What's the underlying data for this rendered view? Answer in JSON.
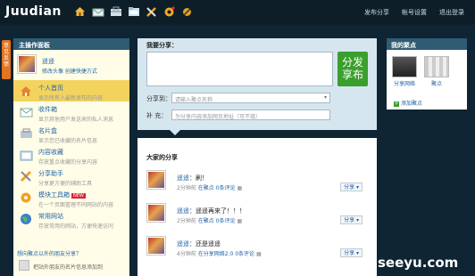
{
  "app": {
    "logo": "Juudian"
  },
  "nav_icons": [
    "home-icon",
    "mail-icon",
    "bag-icon",
    "folder-icon",
    "tools-icon",
    "gear-icon",
    "settings-icon"
  ],
  "top_links": [
    "发布分享",
    "帐号设置",
    "退出登录"
  ],
  "side_tab": "意见反馈",
  "sidebar": {
    "title": "主操作面板",
    "user": {
      "name": "遥遥",
      "links": "修改头像  创建快捷方式"
    },
    "items": [
      {
        "title": "个人首页",
        "sub": "显示所有人最新发布的内容",
        "icon": "home-icon",
        "active": true
      },
      {
        "title": "收件箱",
        "sub": "显示其他用户发送来的私人消息",
        "icon": "inbox-icon",
        "active": false
      },
      {
        "title": "名片盒",
        "sub": "显示您已收藏的名片信息",
        "icon": "card-icon",
        "active": false
      },
      {
        "title": "内容收藏",
        "sub": "存放重点收藏的分享内容",
        "icon": "collection-icon",
        "active": false
      },
      {
        "title": "分享助手",
        "sub": "分享更方便的辅助工具",
        "icon": "tools-icon",
        "active": false
      },
      {
        "title": "模块工具箱",
        "sub": "在一个页面管理不同网站的内容",
        "icon": "toolbox-icon",
        "active": false,
        "badge": "NEW"
      },
      {
        "title": "常用网站",
        "sub": "存放常用的网站，方便快速访问",
        "icon": "globe-icon",
        "active": false
      }
    ],
    "footer_question": "想向聚点以外的朋友分享？",
    "footer_text": "把站外朋友的名片信息添加到"
  },
  "composer": {
    "title": "我要分享：",
    "post_label": "分发享布",
    "share_to_label": "分享到：",
    "share_to_placeholder": "请输入聚点名称",
    "supplement_label": "补  充：",
    "supplement_placeholder": "为分享内容添加网页地址（可不填）"
  },
  "feed": {
    "title": "大家的分享",
    "posts": [
      {
        "user": "遥遥",
        "text": "：刷！",
        "time": "2分钟前",
        "location": "在聚点",
        "comments": "0条评论",
        "share": "分享"
      },
      {
        "user": "遥遥",
        "text": "：遥遥再来了！！！",
        "time": "2分钟前",
        "location": "在聚点",
        "comments": "0条评论",
        "share": "分享"
      },
      {
        "user": "遥遥",
        "text": "：还是遥遥",
        "time": "4分钟前",
        "location": "在分享网络2.0",
        "comments": "0条评论",
        "share": "分享"
      }
    ]
  },
  "right_panel": {
    "title": "我的聚点",
    "spots": [
      {
        "label": "分享网络"
      },
      {
        "label": "聚点"
      }
    ],
    "add_label": "添加聚点"
  },
  "watermark": "seeyu.com",
  "colors": {
    "header": "#0e1e29",
    "panel_head": "#2f5b73",
    "sidebar_bg": "#fffde7",
    "active_item": "#f3d35e",
    "post_button": "#3a9f2d",
    "link": "#1f63a6",
    "side_tab": "#e37421",
    "composer_bg": "#d6e6ef"
  }
}
